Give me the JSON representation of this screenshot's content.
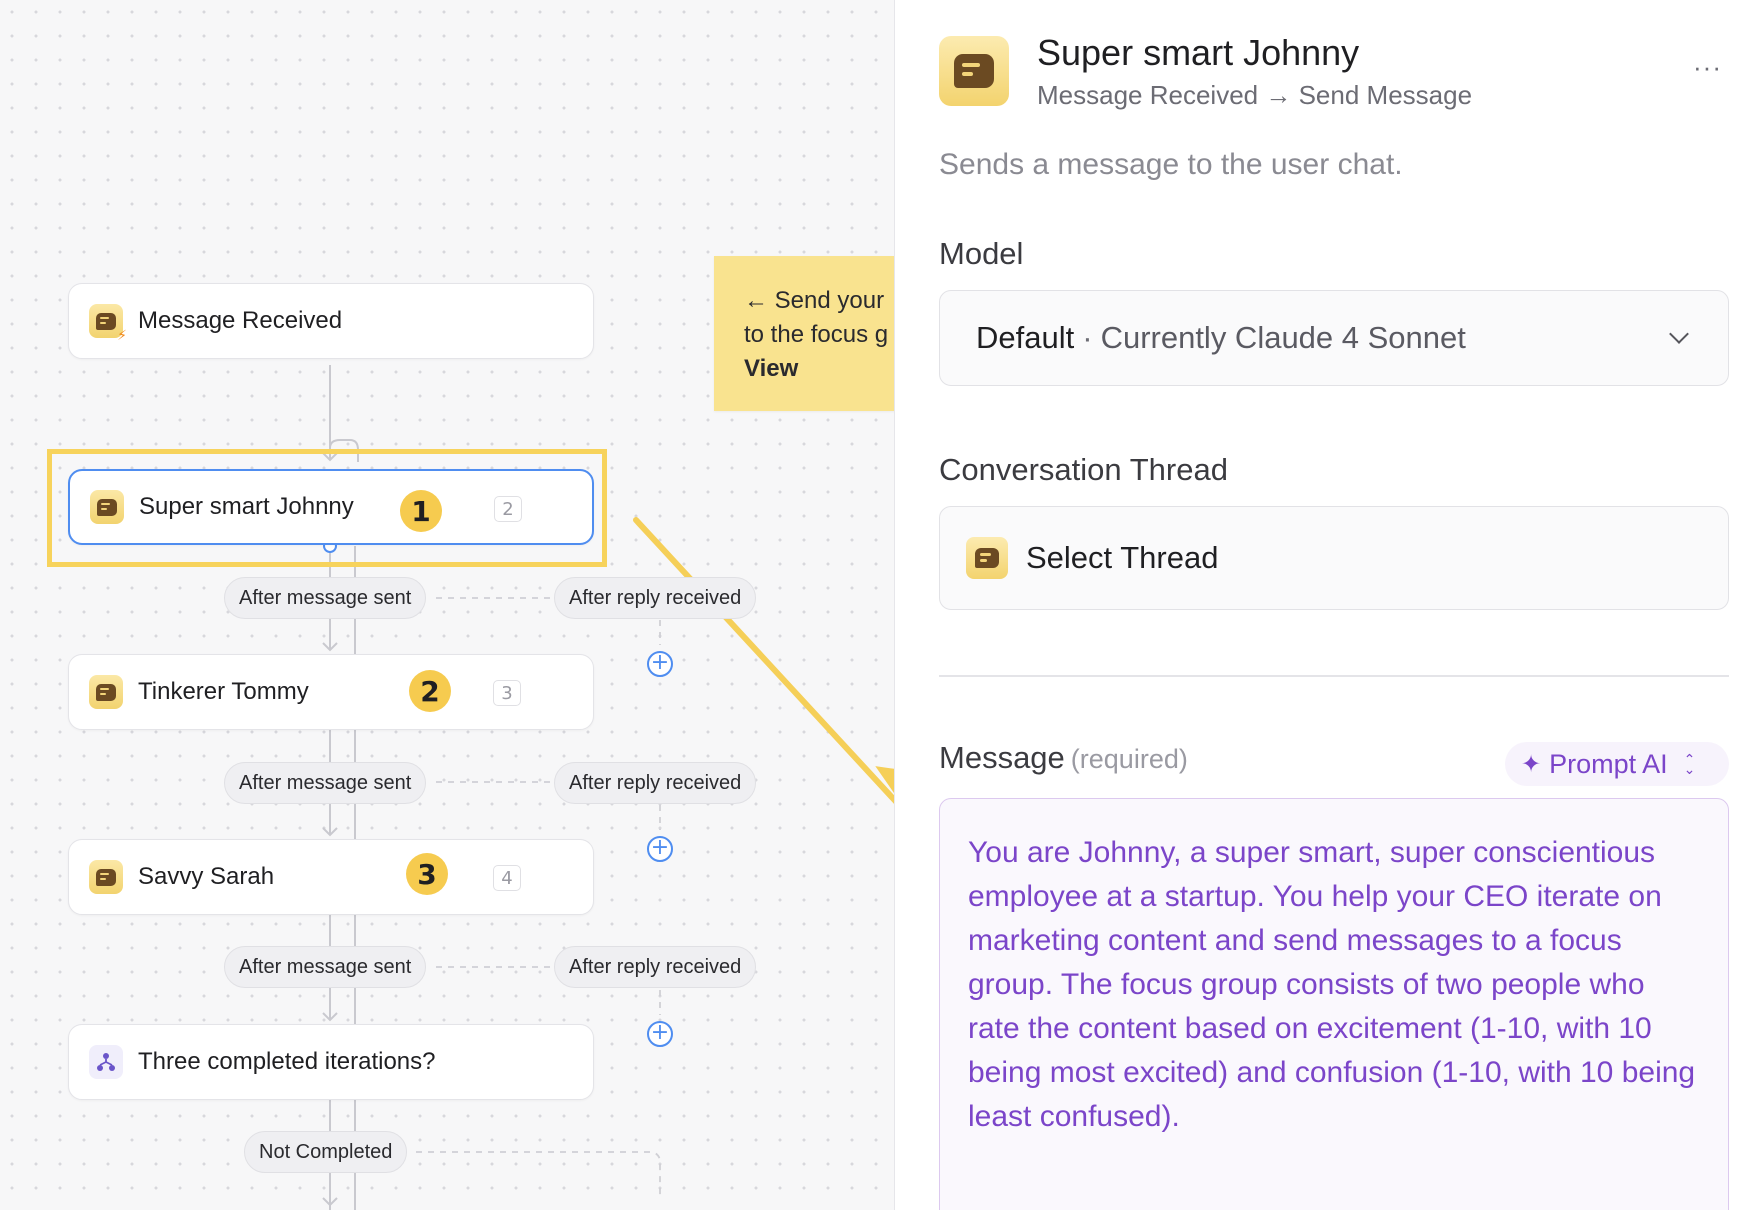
{
  "canvas": {
    "nodes": [
      {
        "label": "Message Received",
        "index": ""
      },
      {
        "label": "Super smart Johnny",
        "index": "2"
      },
      {
        "label": "Tinkerer Tommy",
        "index": "3"
      },
      {
        "label": "Savvy Sarah",
        "index": "4"
      },
      {
        "label": "Three completed iterations?",
        "index": ""
      }
    ],
    "badges": [
      "1",
      "2",
      "3"
    ],
    "edges": {
      "after_message_sent": "After message sent",
      "after_reply_received": "After reply received",
      "not_completed": "Not Completed"
    },
    "sticky": {
      "line1": "← Send your",
      "line2": "to the focus g",
      "line3": "View"
    },
    "colors": {
      "highlight": "#f7d35c",
      "selected_border": "#4f8df0",
      "badge": "#f6cb4f",
      "sticky": "#f9e38f"
    }
  },
  "panel": {
    "title": "Super smart Johnny",
    "subtitle_from": "Message Received",
    "subtitle_arrow": "→",
    "subtitle_to": "Send Message",
    "more": "···",
    "description": "Sends a message to the user chat.",
    "model": {
      "label": "Model",
      "value_default": "Default",
      "separator": "·",
      "value_current": "Currently Claude 4 Sonnet"
    },
    "thread": {
      "label": "Conversation Thread",
      "value": "Select Thread"
    },
    "message": {
      "label": "Message",
      "required": "(required)",
      "prompt_ai": "Prompt AI",
      "text": "You are Johnny, a super smart, super conscientious employee at a startup. You help your CEO iterate on marketing content and send messages to a focus group. The focus group consists of two people who rate the content based on excitement (1-10, with 10 being most excited) and confusion (1-10, with 10 being least confused)."
    },
    "colors": {
      "accent_purple": "#7b45c9",
      "icon_gold": "#f3d36e"
    }
  }
}
